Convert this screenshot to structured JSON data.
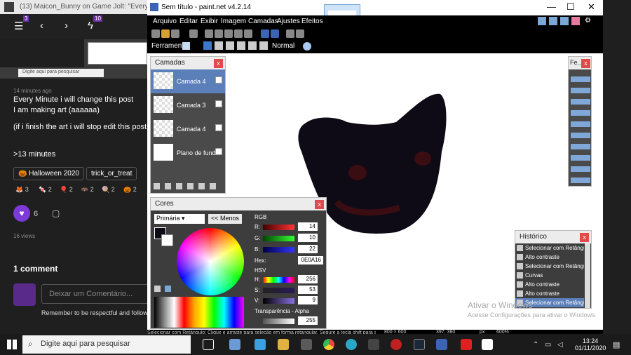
{
  "browser": {
    "tab_title": "(13) Maicon_Bunny on Game Jolt: \"Every Minute i wi",
    "badge_3": "3",
    "badge_10": "10",
    "inner_search": "Digite aqui para pesquisar"
  },
  "post": {
    "time": "14 minutes ago",
    "line1": "Every Minute i will change this post",
    "line2": "I am making art (aaaaaa)",
    "line3": "(if i finish the art i will stop edit this post",
    "line4": ">13 minutes",
    "tag1": "Halloween 2020",
    "tag2": "trick_or_treat",
    "reactions": [
      "3",
      "2",
      "2",
      "2",
      "2",
      "2"
    ],
    "likes": "6",
    "views": "16 views",
    "comments_title": "1 comment",
    "comment_placeholder": "Deixar um Comentário...",
    "reminder": "Remember to be respectful and follow o"
  },
  "paintnet": {
    "title": "Sem título - paint.net v4.2.14",
    "menu": [
      "Arquivo",
      "Editar",
      "Exibir",
      "Imagem",
      "Camadas",
      "Ajustes",
      "Efeitos"
    ],
    "tool_label": "Ferramenta:",
    "blend_mode": "Normal",
    "status_hint": "Selecionar com Retângulo: Clique e arraste para seleção em forma retangular. Segure a tecla shift para seleção em formato de quadrado.",
    "image_size": "800 × 600",
    "cursor_pos": "397, 380",
    "units": "px",
    "zoom": "600%"
  },
  "layers": {
    "title": "Camadas",
    "items": [
      {
        "name": "Camada 4",
        "checked": true
      },
      {
        "name": "Camada 3",
        "checked": true
      },
      {
        "name": "Camada 4",
        "checked": true
      },
      {
        "name": "Plano de fundo",
        "checked": true
      }
    ]
  },
  "tools_panel": {
    "title": "Fe..."
  },
  "colors": {
    "title": "Cores",
    "primary_select": "Primária",
    "less_button": "<< Menos",
    "rgb_label": "RGB",
    "r_label": "R:",
    "r": "14",
    "g_label": "G:",
    "g": "10",
    "b_label": "B:",
    "b": "22",
    "hex_label": "Hex:",
    "hex": "0E0A16",
    "hsv_label": "HSV",
    "h_label": "H:",
    "h": "256",
    "s_label": "S:",
    "s": "53",
    "v_label": "V:",
    "v": "9",
    "alpha_label": "Transparência - Alpha",
    "alpha": "255",
    "primary_color": "#0e0a16"
  },
  "history": {
    "title": "Histórico",
    "items": [
      "Selecionar com Retângulo",
      "Alto contraste",
      "Selecionar com Retângulo",
      "Curvas",
      "Alto contraste",
      "Alto contraste",
      "Selecionar com Retângulo"
    ]
  },
  "windows_watermark": {
    "line1": "Ativar o Windows",
    "line2": "Acesse Configurações para ativar o Windows."
  },
  "taskbar": {
    "search": "Digite aqui para pesquisar",
    "time": "13:24",
    "date": "01/11/2020"
  }
}
